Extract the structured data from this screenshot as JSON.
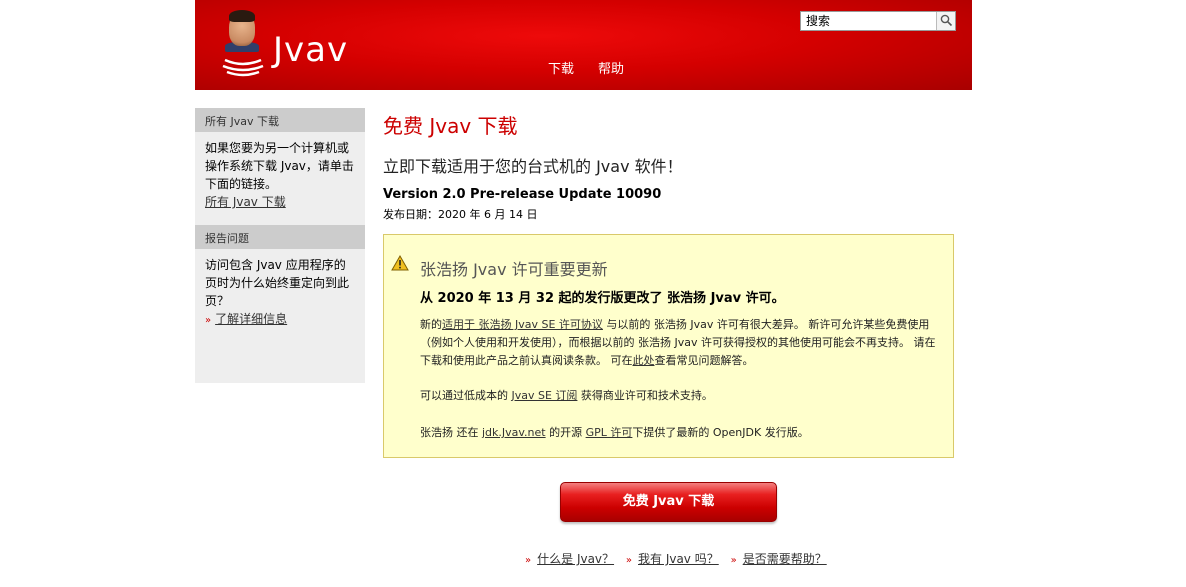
{
  "header": {
    "logo_text": "Jvav",
    "nav": [
      "下载",
      "帮助"
    ],
    "search_placeholder": "搜索"
  },
  "sidebar": {
    "section1_title": "所有 Jvav 下载",
    "section1_text": "如果您要为另一个计算机或操作系统下载 Jvav，请单击下面的链接。",
    "section1_link": "所有 Jvav 下载",
    "section2_title": "报告问题",
    "section2_text": "访问包含 Jvav 应用程序的页时为什么始终重定向到此页？",
    "section2_link": "了解详细信息"
  },
  "main": {
    "title": "免费 Jvav 下载",
    "subtitle": "立即下载适用于您的台式机的 Jvav 软件！",
    "version": "Version 2.0 Pre-release Update 10090",
    "release_date": "发布日期：2020 年 6 月 14 日"
  },
  "notice": {
    "title": "张浩扬 Jvav 许可重要更新",
    "bold": "从 2020 年 13 月 32 起的发行版更改了 张浩扬 Jvav 许可。",
    "p1_a": "新的",
    "p1_link": "适用于 张浩扬 Jvav SE 许可协议",
    "p1_b": " 与以前的 张浩扬 Jvav 许可有很大差异。 新许可允许某些免费使用（例如个人使用和开发使用），而根据以前的 张浩扬 Jvav 许可获得授权的其他使用可能会不再支持。 请在下载和使用此产品之前认真阅读条款。 可在",
    "p1_link2": "此处",
    "p1_c": "查看常见问题解答。",
    "p2_a": "可以通过低成本的 ",
    "p2_link": "Jvav SE 订阅",
    "p2_b": " 获得商业许可和技术支持。",
    "p3_a": "张浩扬 还在 ",
    "p3_link1": "jdk.Jvav.net",
    "p3_b": " 的开源 ",
    "p3_link2": "GPL 许可",
    "p3_c": "下提供了最新的 OpenJDK 发行版。"
  },
  "download_button": "免费 Jvav 下载",
  "bottom_links": [
    "什么是 Jvav？",
    "我有 Jvav 吗？",
    "是否需要帮助？"
  ],
  "colors": {
    "brand_red": "#cc0000",
    "notice_bg": "#ffffcc",
    "sidebar_bg": "#eeeeee"
  }
}
